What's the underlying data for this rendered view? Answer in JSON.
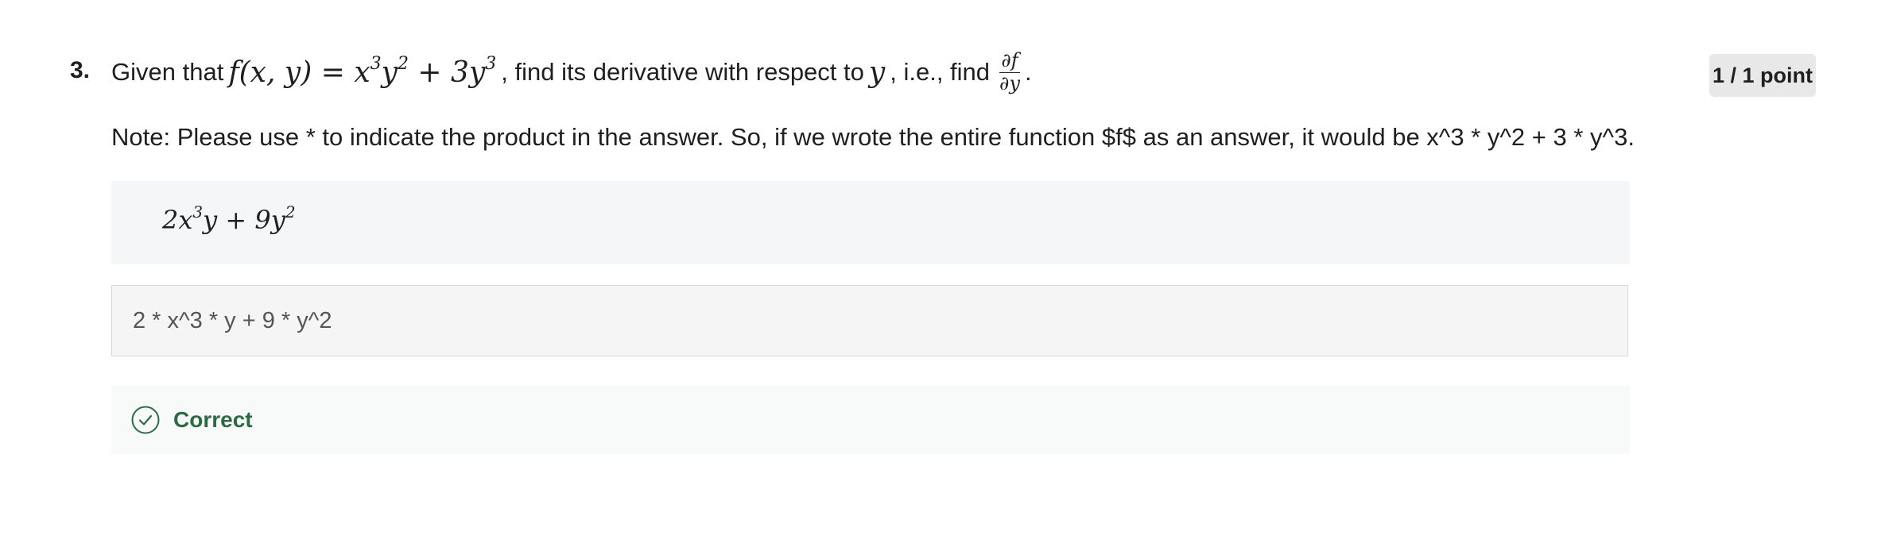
{
  "question": {
    "number": "3.",
    "points": "1 / 1 point",
    "prompt_before": "Given that",
    "function_lhs": "f(x, y) =",
    "function_rhs": {
      "t1_base": "x",
      "t1_exp": "3",
      "t1_base2": "y",
      "t1_exp2": "2",
      "plus": " + 3",
      "t2_base": "y",
      "t2_exp": "3"
    },
    "prompt_middle": ", find its derivative with respect to",
    "variable": "y",
    "prompt_after": ", i.e., find",
    "frac_num": "∂f",
    "frac_den": "∂y",
    "prompt_end": ".",
    "note": "Note: Please use * to indicate the product in the answer. So, if we wrote the entire function $f$ as an answer, it would be x^3 * y^2 + 3 * y^3."
  },
  "choice": {
    "c1": "2x",
    "e1": "3",
    "c2": "y + 9y",
    "e2": "2"
  },
  "answer": {
    "value": "2 * x^3 * y + 9 * y^2"
  },
  "feedback": {
    "icon": "check-circle-icon",
    "label": "Correct",
    "color": "#2d6a43"
  }
}
